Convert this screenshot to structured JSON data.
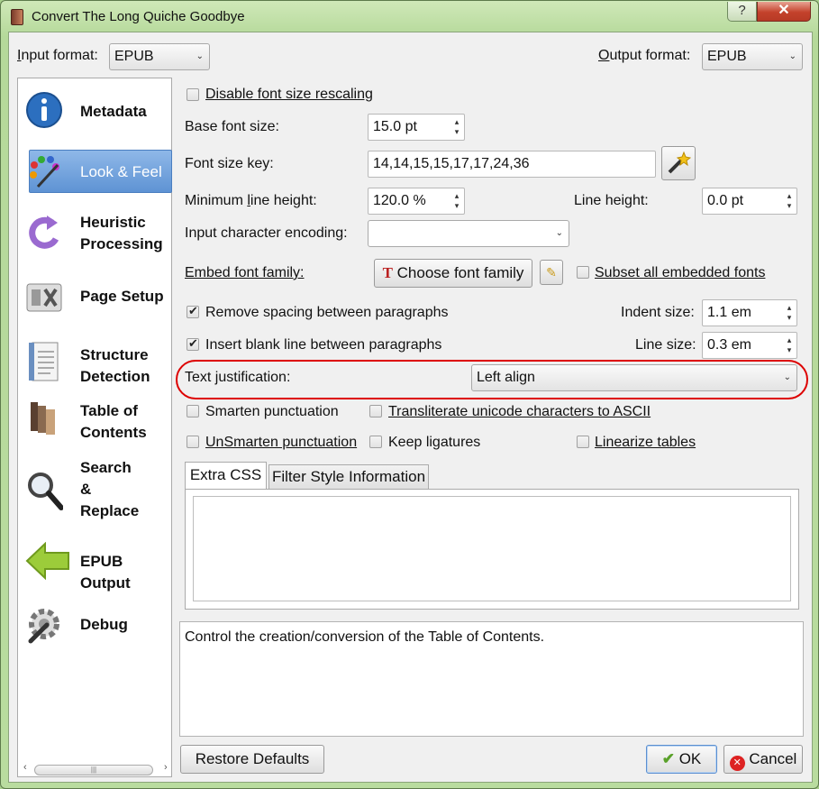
{
  "window": {
    "title": "Convert The Long Quiche Goodbye",
    "help_label": "?",
    "close_label": "✕"
  },
  "input_format": {
    "label": "Input format:",
    "value": "EPUB"
  },
  "output_format": {
    "label": "Output format:",
    "value": "EPUB"
  },
  "sidebar": {
    "items": [
      {
        "label": "Metadata",
        "icon": "info-icon"
      },
      {
        "label": "Look & Feel",
        "icon": "palette-icon",
        "selected": true
      },
      {
        "label": "Heuristic\nProcessing",
        "icon": "refresh-arrow-icon"
      },
      {
        "label": "Page Setup",
        "icon": "tools-icon"
      },
      {
        "label": "Structure\nDetection",
        "icon": "document-icon"
      },
      {
        "label": "Table of\nContents",
        "icon": "books-icon"
      },
      {
        "label": "Search\n&\nReplace",
        "icon": "magnifier-icon"
      },
      {
        "label": "EPUB Output",
        "icon": "arrow-left-icon"
      },
      {
        "label": "Debug",
        "icon": "gear-icon"
      }
    ],
    "scroll_handle": "|||"
  },
  "form": {
    "disable_rescaling": {
      "label": "Disable font size rescaling",
      "checked": false
    },
    "base_font_size": {
      "label": "Base font size:",
      "value": "15.0 pt"
    },
    "font_size_key": {
      "label": "Font size key:",
      "value": "14,14,15,15,17,17,24,36"
    },
    "min_line_height": {
      "label": "Minimum line height:",
      "value": "120.0 %"
    },
    "line_height": {
      "label": "Line height:",
      "value": "0.0 pt"
    },
    "input_encoding": {
      "label": "Input character encoding:",
      "value": ""
    },
    "embed_font": {
      "label": "Embed font family:",
      "button": "Choose font family"
    },
    "subset_fonts": {
      "label": "Subset all embedded fonts",
      "checked": false
    },
    "remove_spacing": {
      "label": "Remove spacing between paragraphs",
      "checked": true
    },
    "indent_size": {
      "label": "Indent size:",
      "value": "1.1 em"
    },
    "insert_blank": {
      "label": "Insert blank line between paragraphs",
      "checked": true
    },
    "line_size": {
      "label": "Line size:",
      "value": "0.3 em"
    },
    "text_justification": {
      "label": "Text justification:",
      "value": "Left align"
    },
    "smarten": {
      "label": "Smarten punctuation",
      "checked": false
    },
    "transliterate": {
      "label": "Transliterate unicode characters to ASCII",
      "checked": false
    },
    "unsmarten": {
      "label": "UnSmarten punctuation",
      "checked": false
    },
    "keep_ligatures": {
      "label": "Keep ligatures",
      "checked": false
    },
    "linearize": {
      "label": "Linearize tables",
      "checked": false
    }
  },
  "tabs": [
    {
      "label": "Extra CSS"
    },
    {
      "label": "Filter Style Information"
    }
  ],
  "help_text": "Control the creation/conversion of the Table of Contents.",
  "buttons": {
    "restore": "Restore Defaults",
    "ok": "OK",
    "cancel": "Cancel"
  },
  "colors": {
    "accent": "#5e93d4",
    "highlight": "#dd0000",
    "frame": "#b5d99a"
  }
}
